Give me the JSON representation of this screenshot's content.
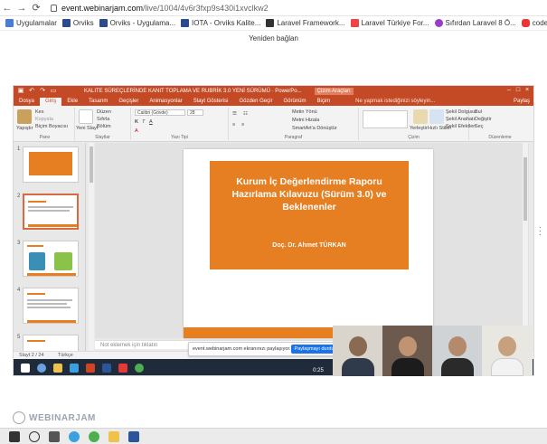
{
  "browser": {
    "url_host": "event.webinarjam.com",
    "url_path": "/live/1004/4v6r3fxp9s430i1xvclkw2"
  },
  "bookmarks": [
    {
      "label": "Uygulamalar",
      "color": "#4a7bd9"
    },
    {
      "label": "Orviks",
      "color": "#2b4c8c"
    },
    {
      "label": "Orviks - Uygulama...",
      "color": "#2b4c8c"
    },
    {
      "label": "IOTA - Orviks Kalite...",
      "color": "#2b4c8c"
    },
    {
      "label": "Laravel Framework...",
      "color": "#333"
    },
    {
      "label": "Laravel Türkiye For...",
      "color": "#e44"
    },
    {
      "label": "Sıfırdan Laravel 8 Ö...",
      "color": "#9b3cc6"
    },
    {
      "label": "codeigniter hocası",
      "color": "#e33"
    }
  ],
  "reconnect_text": "Yeniden bağlan",
  "powerpoint": {
    "doc_title": "KALITE SÜREÇLERİNDE KANIT TOPLAMA VE RUBRİK 3.0 YENİ SÜRÜMÜ · PowerPo...",
    "context_tab": "Çizim Araçları",
    "tabs": [
      "Dosya",
      "Giriş",
      "Ekle",
      "Tasarım",
      "Geçişler",
      "Animasyonlar",
      "Slayt Gösterisi",
      "Gözden Geçir",
      "Görünüm",
      "Biçim"
    ],
    "search_hint": "Ne yapmak istediğinizi söyleyin...",
    "share_label": "Paylaş",
    "ribbon": {
      "paste": "Yapıştır",
      "cut": "Kes",
      "copy": "Kopyala",
      "format_painter": "Biçim Boyacısı",
      "clipboard_group": "Pano",
      "new_slide": "Yeni Slayt",
      "layout": "Düzen",
      "reset": "Sıfırla",
      "section": "Bölüm",
      "slides_group": "Slaytlar",
      "font_name": "Calibri (Gövde)",
      "font_size": "28",
      "font_group": "Yazı Tipi",
      "text_direction": "Metin Yönü",
      "align_text": "Metni Hizala",
      "smartart": "SmartArt'a Dönüştür",
      "paragraph_group": "Paragraf",
      "drawing_group": "Çizim",
      "arrange": "Yerleştir",
      "quick_styles": "Hızlı Stiller",
      "shape_fill": "Şekil Dolgusu",
      "shape_outline": "Şekil Anahatı",
      "shape_effects": "Şekil Efektleri",
      "find": "Bul",
      "replace": "Değiştir",
      "select": "Seç",
      "editing_group": "Düzenleme"
    },
    "thumb_numbers": [
      "1",
      "2",
      "3",
      "4",
      "5"
    ],
    "slide": {
      "title": "Kurum İç Değerlendirme Raporu Hazırlama Kılavuzu (Sürüm 3.0) ve Beklenenler",
      "author": "Doç. Dr. Ahmet TÜRKAN"
    },
    "notes_placeholder": "Not eklemek için tıklatın",
    "status": [
      "Slayt 2 / 24",
      "Türkçe"
    ]
  },
  "share_bar": {
    "message": "event.webinarjam.com ekranınızı paylaşıyor.",
    "stop_label": "Paylaşmayı durdur"
  },
  "timer": "0:25",
  "brand": "WEBINARJAM",
  "colors": {
    "ppt_red": "#c44a26",
    "slide_orange": "#e67e22"
  }
}
